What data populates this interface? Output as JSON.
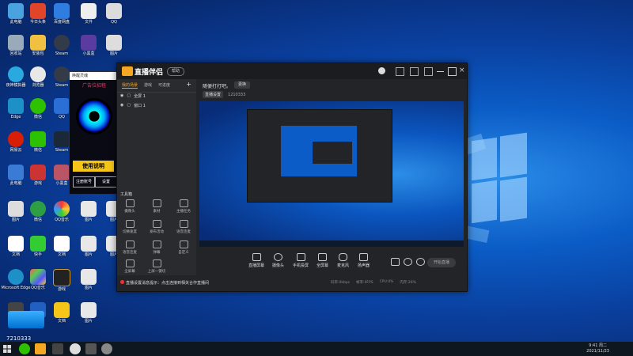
{
  "desktop": {
    "icons": [
      {
        "label": "此电脑",
        "color": "#4aa3df"
      },
      {
        "label": "今日头条",
        "color": "#e0452a"
      },
      {
        "label": "百度网盘",
        "color": "#2f7de1"
      },
      {
        "label": "文件",
        "color": "#eeeeee"
      },
      {
        "label": "QQ",
        "color": "#dcdcdc"
      },
      {
        "label": "回收站",
        "color": "#9ab"
      },
      {
        "label": "安装包",
        "color": "#f0c040"
      },
      {
        "label": "Steam",
        "color": "#333a48"
      },
      {
        "label": "小黑盒",
        "color": "#5a3ca0"
      },
      {
        "label": "夜神模拟器",
        "color": "#2aa8e0"
      },
      {
        "label": "浏览器",
        "color": "#e8e8e8"
      },
      {
        "label": "微信",
        "color": "#2dc100"
      },
      {
        "label": "Steam",
        "color": "#1b2838"
      },
      {
        "label": "Edge",
        "color": "#1e90c8"
      },
      {
        "label": "QQ音乐",
        "color": "#f5c518"
      },
      {
        "label": "酷狗",
        "color": "#2080ff"
      },
      {
        "label": "快手",
        "color": "#ff6a00"
      },
      {
        "label": "网易云",
        "color": "#d81e06"
      },
      {
        "label": "游戏",
        "color": "#b03030"
      },
      {
        "label": "图片",
        "color": "#ffffff"
      },
      {
        "label": "文档",
        "color": "#ffffff"
      },
      {
        "label": "Microsoft Edge",
        "color": "#1e90c8"
      },
      {
        "label": "图片",
        "color": "#e8e8e8"
      },
      {
        "label": "图片",
        "color": "#e8e8e8"
      }
    ]
  },
  "promo": {
    "top": "唤醒灵魂",
    "headline": "广告位招租",
    "cta": "使用说明",
    "btn1": "注册账号",
    "btn2": "设置"
  },
  "app": {
    "brand": "直播伴侣",
    "help": "帮助",
    "left_tabs": [
      "我的场景",
      "游戏",
      "可进度"
    ],
    "scenes": [
      "全屏 1",
      "窗口 1"
    ],
    "tools_header": "工具箱",
    "tools": [
      "摄像头",
      "素材",
      "主播任务",
      "切换速度",
      "发布活动",
      "语音连麦",
      "语音连麦",
      "弹幕",
      "自定义",
      "全屏幕",
      "上屏一键切"
    ],
    "preview_title": "随便打打吧。",
    "preview_tag": "更换",
    "sub_chip": "直播设置",
    "sub_text": "1210333",
    "bottom_buttons": [
      "直播屏幕",
      "摄像头",
      "手机投屏",
      "全屏幕",
      "麦克风",
      "扬声器"
    ],
    "live_button": "开始直播",
    "notice": "直播设置消息提示：点击连接到相关合作直播间",
    "status": [
      "码率:0kbps",
      "帧率:0FPS",
      "CPU:4%",
      "内存:26%"
    ]
  },
  "live_badge": {
    "id": "7210333"
  },
  "taskbar": {
    "time": "9:41 周二",
    "date": "2021/11/23"
  }
}
